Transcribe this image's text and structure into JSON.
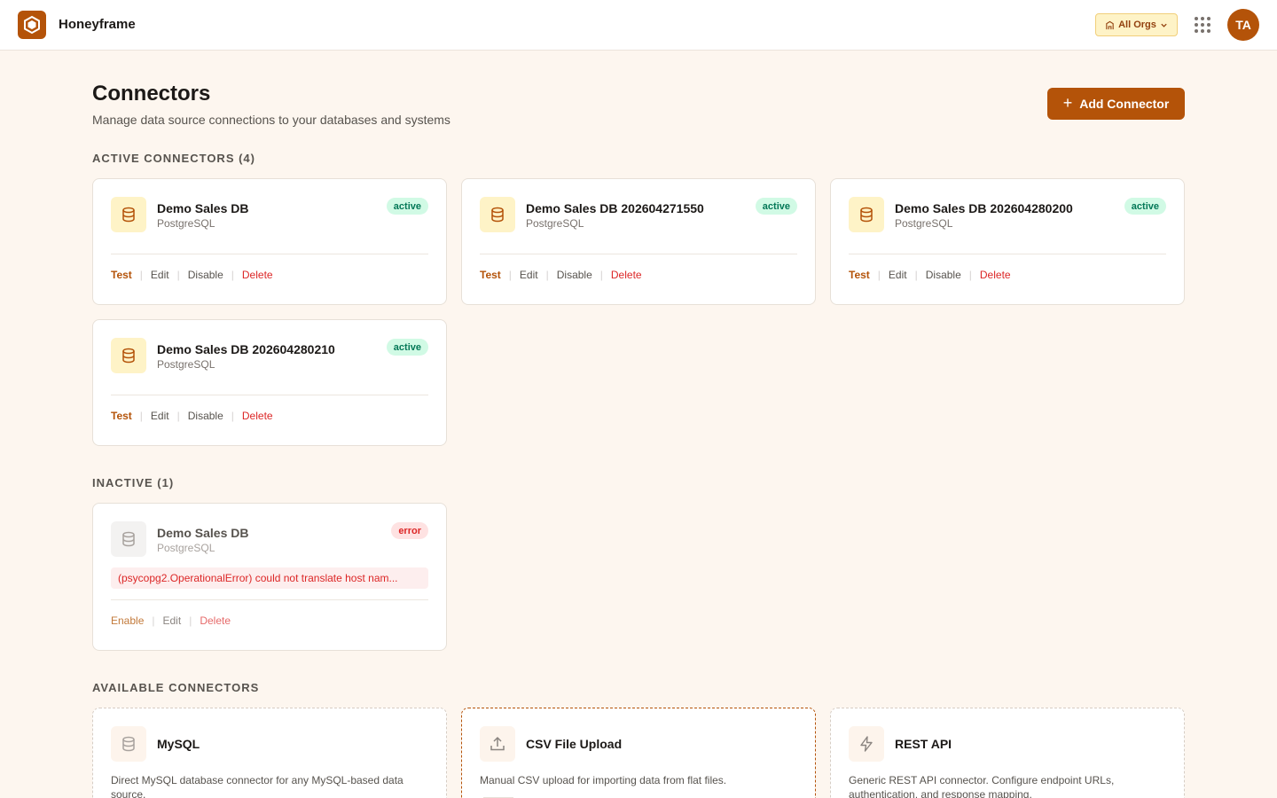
{
  "app": {
    "name": "Honeyframe",
    "org_switch": "All Orgs",
    "avatar_initials": "TA",
    "brand_color": "#b45309"
  },
  "header": {
    "title": "Connectors",
    "subtitle": "Manage data source connections to your databases and systems",
    "add_button": "Add Connector"
  },
  "sections": {
    "active": "ACTIVE CONNECTORS (4)",
    "inactive": "INACTIVE (1)",
    "available": "AVAILABLE CONNECTORS"
  },
  "actions": {
    "test": "Test",
    "edit": "Edit",
    "disable": "Disable",
    "delete": "Delete",
    "enable": "Enable"
  },
  "active_connectors": [
    {
      "name": "Demo Sales DB",
      "type": "PostgreSQL",
      "status": "active",
      "icon": "database-icon"
    },
    {
      "name": "Demo Sales DB 202604271550",
      "type": "PostgreSQL",
      "status": "active",
      "icon": "database-icon"
    },
    {
      "name": "Demo Sales DB 202604280200",
      "type": "PostgreSQL",
      "status": "active",
      "icon": "database-icon"
    },
    {
      "name": "Demo Sales DB 202604280210",
      "type": "PostgreSQL",
      "status": "active",
      "icon": "database-icon"
    }
  ],
  "inactive_connectors": [
    {
      "name": "Demo Sales DB",
      "type": "PostgreSQL",
      "status": "error",
      "error": "(psycopg2.OperationalError) could not translate host nam...",
      "icon": "database-icon"
    }
  ],
  "available_connectors": [
    {
      "name": "MySQL",
      "description": "Direct MySQL database connector for any MySQL-based data source.",
      "icon": "database-icon"
    },
    {
      "name": "CSV File Upload",
      "description": "Manual CSV upload for importing data from flat files.",
      "icon": "upload-icon"
    },
    {
      "name": "REST API",
      "description": "Generic REST API connector. Configure endpoint URLs, authentication, and response mapping.",
      "icon": "lightning-icon"
    }
  ]
}
